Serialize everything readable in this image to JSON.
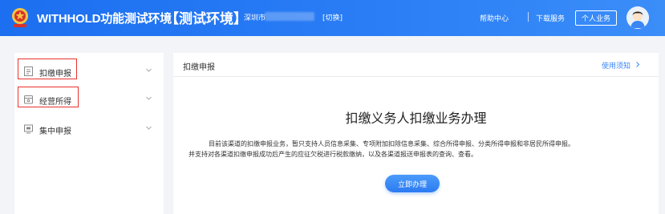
{
  "header": {
    "app_title": "WITHHOLD功能测试环境",
    "env_title": "【测试环境】",
    "region": "深圳市",
    "switch_label": "[切换]",
    "help_label": "帮助中心",
    "download_label": "下载服务",
    "personal_label": "个人业务"
  },
  "sidebar": {
    "items": [
      {
        "label": "扣缴申报",
        "icon": "document-icon"
      },
      {
        "label": "经营所得",
        "icon": "wallet-icon"
      },
      {
        "label": "集中申报",
        "icon": "screen-icon"
      }
    ]
  },
  "main": {
    "title": "扣缴申报",
    "guide_link": "使用须知",
    "heading": "扣缴义务人扣缴业务办理",
    "desc_line1": "目前该渠道的扣缴申报业务，暂只支持人员信息采集、专项附加扣除信息采集、综合所得申报、分类所得申报和非居民所得申报。",
    "desc_line2": "并支持对各渠道扣缴申报成功后产生的应征欠税进行税款缴纳，以及各渠道报送申报表的查询、查看。",
    "start_button": "立即办理"
  },
  "colors": {
    "header_blue": "#2a7df5",
    "accent_blue": "#3a86f4",
    "highlight_red": "#e8322d"
  }
}
